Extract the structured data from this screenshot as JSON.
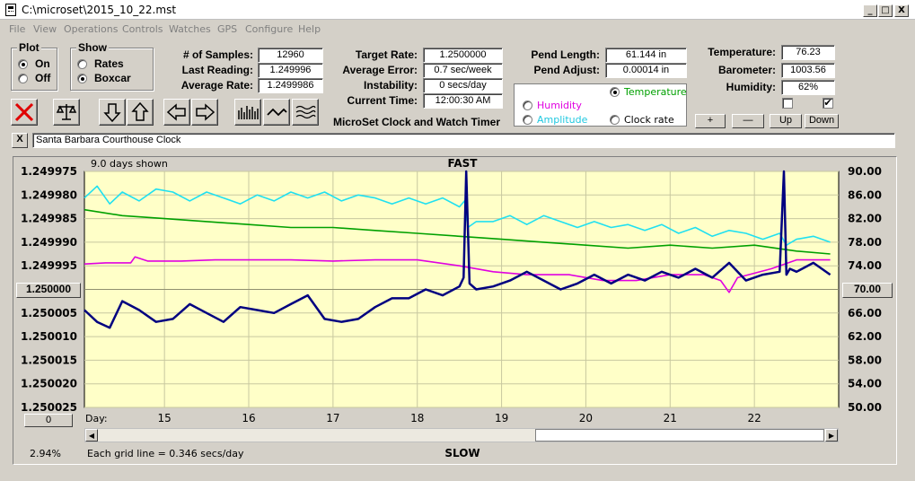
{
  "window": {
    "title": "C:\\microset\\2015_10_22.mst",
    "min_label": "_",
    "max_label": "□",
    "close_label": "X"
  },
  "menu": [
    "File",
    "View",
    "Operations",
    "Controls",
    "Watches",
    "GPS",
    "Configure",
    "Help"
  ],
  "plot_group": {
    "title": "Plot",
    "options": [
      {
        "label": "On",
        "selected": true
      },
      {
        "label": "Off",
        "selected": false
      }
    ]
  },
  "show_group": {
    "title": "Show",
    "options": [
      {
        "label": "Rates",
        "selected": false
      },
      {
        "label": "Boxcar",
        "selected": true
      }
    ]
  },
  "stats": {
    "samples_label": "# of Samples:",
    "samples": "12960",
    "last_label": "Last Reading:",
    "last": "1.249996",
    "avg_rate_label": "Average Rate:",
    "avg_rate": "1.2499986",
    "target_label": "Target Rate:",
    "target": "1.2500000",
    "avg_err_label": "Average Error:",
    "avg_err": "0.7 sec/week",
    "instab_label": "Instability:",
    "instab": "0 secs/day",
    "time_label": "Current Time:",
    "time": "12:00:30 AM",
    "pend_len_label": "Pend Length:",
    "pend_len": "61.144 in",
    "pend_adj_label": "Pend Adjust:",
    "pend_adj": "0.00014 in",
    "temp_label": "Temperature:",
    "temp": "76.23",
    "baro_label": "Barometer:",
    "baro": "1003.56",
    "hum_label": "Humidity:",
    "hum": "62%"
  },
  "app_caption": "MicroSet Clock and Watch Timer",
  "sensor_group": {
    "temperature": "Temperature",
    "humidity": "Humidity",
    "amplitude": "Amplitude",
    "clock_rate": "Clock rate"
  },
  "sensor_buttons": {
    "plus": "+",
    "minus": "—",
    "up": "Up",
    "down": "Down"
  },
  "clock_name": "Santa Barbara Courthouse Clock",
  "clock_close": "X",
  "colors": {
    "rate": "#000080",
    "temperature": "#00a000",
    "humidity": "#e000e0",
    "amplitude": "#20e0f0",
    "plot_bg": "#ffffc8"
  },
  "chart_data": {
    "type": "line",
    "title": "FAST",
    "bottom_title": "SLOW",
    "days_shown": "9.0 days shown",
    "grid_note": "Each grid line = 0.346 secs/day",
    "zoom": "2.94%",
    "xlabel": "Day:",
    "x_ticks": [
      "15",
      "16",
      "17",
      "18",
      "19",
      "20",
      "21",
      "22"
    ],
    "x_range": [
      14.05,
      23.0
    ],
    "y_left_ticks": [
      "1.249975",
      "1.249980",
      "1.249985",
      "1.249990",
      "1.249995",
      "1.250000",
      "1.250005",
      "1.250010",
      "1.250015",
      "1.250020",
      "1.250025"
    ],
    "y_left_center_button": "1.250000",
    "y_left_bottom_button": "0",
    "y_right_ticks": [
      "90.00",
      "86.00",
      "82.00",
      "78.00",
      "74.00",
      "70.00",
      "66.00",
      "62.00",
      "58.00",
      "54.00",
      "50.00"
    ],
    "y_right_center_button": "70.00",
    "y_right_range": [
      50,
      90
    ],
    "series": [
      {
        "key": "rate",
        "x": [
          14.05,
          14.2,
          14.35,
          14.5,
          14.7,
          14.9,
          15.1,
          15.3,
          15.5,
          15.7,
          15.9,
          16.1,
          16.3,
          16.5,
          16.7,
          16.9,
          17.1,
          17.3,
          17.5,
          17.7,
          17.9,
          18.1,
          18.3,
          18.5,
          18.55,
          18.58,
          18.62,
          18.7,
          18.9,
          19.1,
          19.3,
          19.5,
          19.7,
          19.9,
          20.1,
          20.3,
          20.5,
          20.7,
          20.9,
          21.1,
          21.3,
          21.5,
          21.7,
          21.9,
          22.1,
          22.3,
          22.35,
          22.38,
          22.42,
          22.5,
          22.7,
          22.9
        ],
        "y": [
          66.5,
          64.5,
          63.5,
          68.0,
          66.5,
          64.5,
          65.0,
          67.5,
          66.0,
          64.5,
          67.0,
          66.5,
          66.0,
          67.5,
          69.0,
          65.0,
          64.5,
          65.0,
          67.0,
          68.5,
          68.5,
          70.0,
          69.0,
          70.5,
          72.0,
          90.0,
          71.0,
          70.0,
          70.5,
          71.5,
          73.0,
          71.5,
          70.0,
          71.0,
          72.5,
          71.0,
          72.5,
          71.5,
          73.0,
          72.0,
          73.5,
          72.0,
          74.5,
          71.5,
          72.5,
          73.0,
          90.0,
          72.5,
          73.5,
          73.0,
          74.5,
          72.5
        ]
      },
      {
        "key": "temperature",
        "x": [
          14.05,
          14.5,
          15.0,
          15.5,
          16.0,
          16.5,
          17.0,
          17.5,
          18.0,
          18.5,
          19.0,
          19.5,
          20.0,
          20.5,
          21.0,
          21.5,
          22.0,
          22.5,
          22.9
        ],
        "y": [
          83.5,
          82.5,
          82.0,
          81.5,
          81.0,
          80.5,
          80.5,
          80.0,
          79.5,
          79.0,
          78.5,
          78.0,
          77.5,
          77.0,
          77.5,
          77.0,
          77.5,
          76.5,
          76.0
        ]
      },
      {
        "key": "humidity",
        "x": [
          14.05,
          14.3,
          14.6,
          14.65,
          14.8,
          15.2,
          15.6,
          16.0,
          16.5,
          17.0,
          17.5,
          18.0,
          18.5,
          18.9,
          19.3,
          19.8,
          20.2,
          20.6,
          21.0,
          21.4,
          21.6,
          21.7,
          21.8,
          22.2,
          22.5,
          22.9
        ],
        "y": [
          74.3,
          74.5,
          74.5,
          75.5,
          74.8,
          74.8,
          75.0,
          75.0,
          75.0,
          74.8,
          75.0,
          75.0,
          74.0,
          73.0,
          72.5,
          72.5,
          71.5,
          71.5,
          72.5,
          72.5,
          71.5,
          69.5,
          72.0,
          73.5,
          75.0,
          75.0
        ]
      },
      {
        "key": "amplitude",
        "x": [
          14.05,
          14.2,
          14.35,
          14.5,
          14.7,
          14.9,
          15.1,
          15.3,
          15.5,
          15.7,
          15.9,
          16.1,
          16.3,
          16.5,
          16.7,
          16.9,
          17.1,
          17.3,
          17.5,
          17.7,
          17.9,
          18.1,
          18.3,
          18.5,
          18.56,
          18.6,
          18.7,
          18.9,
          19.1,
          19.3,
          19.5,
          19.7,
          19.9,
          20.1,
          20.3,
          20.5,
          20.7,
          20.9,
          21.1,
          21.3,
          21.5,
          21.7,
          21.9,
          22.1,
          22.3,
          22.38,
          22.5,
          22.7,
          22.9
        ],
        "y": [
          85.5,
          87.5,
          84.5,
          86.5,
          85.0,
          87.0,
          86.5,
          85.0,
          86.5,
          85.5,
          84.5,
          86.0,
          85.0,
          86.5,
          85.5,
          86.5,
          85.0,
          86.0,
          85.5,
          84.5,
          85.5,
          84.5,
          85.5,
          84.0,
          85.0,
          80.5,
          81.5,
          81.5,
          82.5,
          81.0,
          82.5,
          81.5,
          80.5,
          81.5,
          80.5,
          81.0,
          80.0,
          81.0,
          79.5,
          80.5,
          79.0,
          80.0,
          79.5,
          78.5,
          79.5,
          77.5,
          78.5,
          79.0,
          78.0
        ]
      }
    ]
  }
}
